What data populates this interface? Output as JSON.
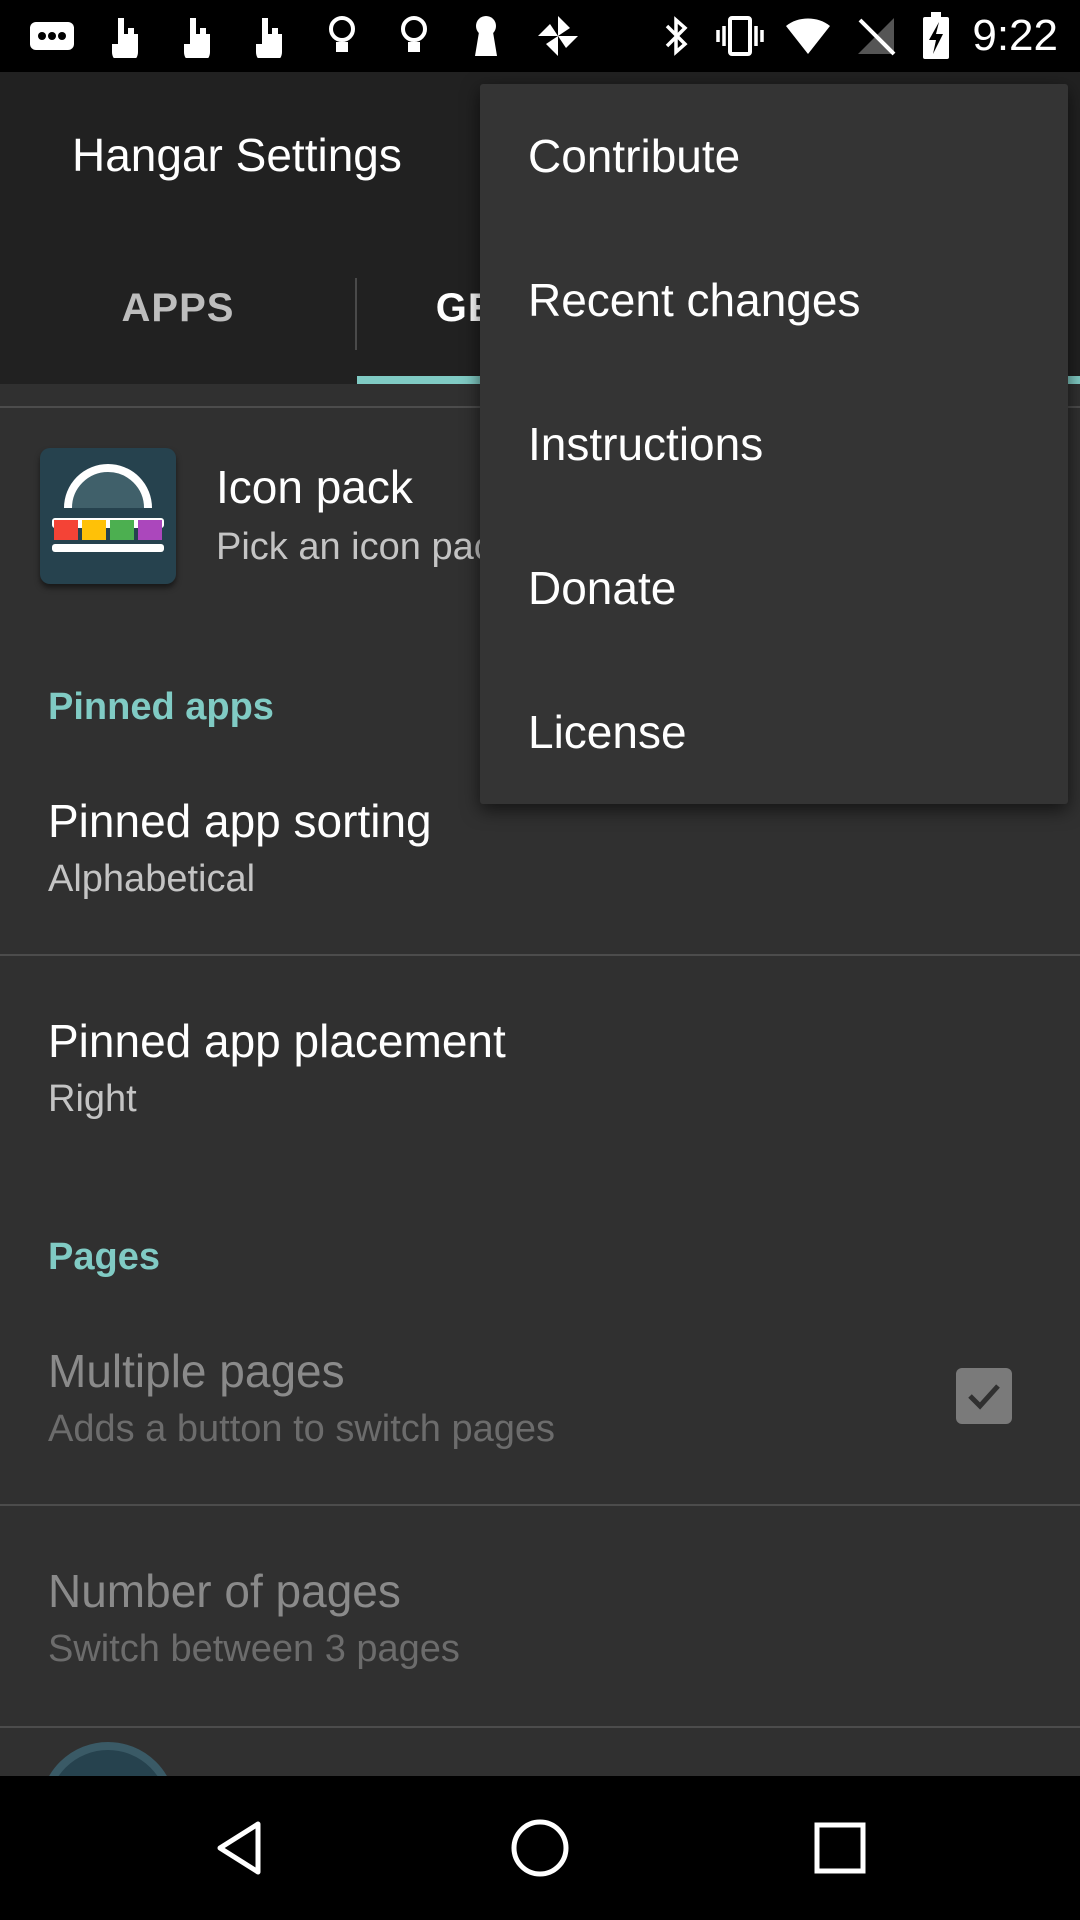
{
  "status_bar": {
    "time": "9:22",
    "icons": [
      "notification-icon",
      "hand-icon",
      "hand-icon",
      "hand-icon",
      "bulb-icon",
      "bulb-icon",
      "keyhole-icon",
      "pinwheel-icon",
      "bluetooth-icon",
      "vibrate-icon",
      "wifi-icon",
      "no-signal-icon",
      "battery-charging-icon"
    ]
  },
  "app_bar": {
    "title": "Hangar Settings",
    "tabs": [
      {
        "label": "APPS",
        "selected": false
      },
      {
        "label": "GENERAL",
        "selected": true
      }
    ]
  },
  "preferences": {
    "icon_pack": {
      "title": "Icon pack",
      "summary": "Pick an icon pack"
    },
    "pinned_section": "Pinned apps",
    "pinned_sorting": {
      "title": "Pinned app sorting",
      "summary": "Alphabetical"
    },
    "pinned_placement": {
      "title": "Pinned app placement",
      "summary": "Right"
    },
    "pages_section": "Pages",
    "multiple_pages": {
      "title": "Multiple pages",
      "summary": "Adds a button to switch pages",
      "checked": true
    },
    "number_of_pages": {
      "title": "Number of pages",
      "summary": "Switch between 3 pages"
    }
  },
  "menu": {
    "items": [
      "Contribute",
      "Recent changes",
      "Instructions",
      "Donate",
      "License"
    ]
  },
  "nav_bar": {
    "buttons": [
      "back-icon",
      "home-icon",
      "recents-icon"
    ]
  },
  "colors": {
    "accent": "#80cbc4",
    "background": "#303030",
    "app_bar": "#212121",
    "menu": "#343434"
  }
}
